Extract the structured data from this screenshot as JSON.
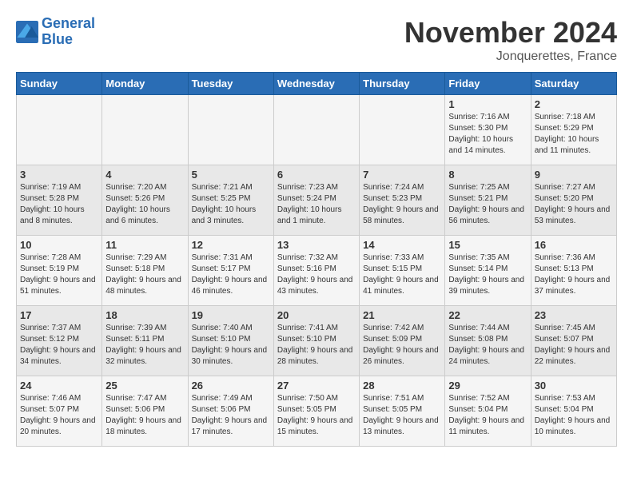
{
  "header": {
    "logo_line1": "General",
    "logo_line2": "Blue",
    "month_title": "November 2024",
    "location": "Jonquerettes, France"
  },
  "weekdays": [
    "Sunday",
    "Monday",
    "Tuesday",
    "Wednesday",
    "Thursday",
    "Friday",
    "Saturday"
  ],
  "weeks": [
    [
      {
        "day": "",
        "info": ""
      },
      {
        "day": "",
        "info": ""
      },
      {
        "day": "",
        "info": ""
      },
      {
        "day": "",
        "info": ""
      },
      {
        "day": "",
        "info": ""
      },
      {
        "day": "1",
        "info": "Sunrise: 7:16 AM\nSunset: 5:30 PM\nDaylight: 10 hours and 14 minutes."
      },
      {
        "day": "2",
        "info": "Sunrise: 7:18 AM\nSunset: 5:29 PM\nDaylight: 10 hours and 11 minutes."
      }
    ],
    [
      {
        "day": "3",
        "info": "Sunrise: 7:19 AM\nSunset: 5:28 PM\nDaylight: 10 hours and 8 minutes."
      },
      {
        "day": "4",
        "info": "Sunrise: 7:20 AM\nSunset: 5:26 PM\nDaylight: 10 hours and 6 minutes."
      },
      {
        "day": "5",
        "info": "Sunrise: 7:21 AM\nSunset: 5:25 PM\nDaylight: 10 hours and 3 minutes."
      },
      {
        "day": "6",
        "info": "Sunrise: 7:23 AM\nSunset: 5:24 PM\nDaylight: 10 hours and 1 minute."
      },
      {
        "day": "7",
        "info": "Sunrise: 7:24 AM\nSunset: 5:23 PM\nDaylight: 9 hours and 58 minutes."
      },
      {
        "day": "8",
        "info": "Sunrise: 7:25 AM\nSunset: 5:21 PM\nDaylight: 9 hours and 56 minutes."
      },
      {
        "day": "9",
        "info": "Sunrise: 7:27 AM\nSunset: 5:20 PM\nDaylight: 9 hours and 53 minutes."
      }
    ],
    [
      {
        "day": "10",
        "info": "Sunrise: 7:28 AM\nSunset: 5:19 PM\nDaylight: 9 hours and 51 minutes."
      },
      {
        "day": "11",
        "info": "Sunrise: 7:29 AM\nSunset: 5:18 PM\nDaylight: 9 hours and 48 minutes."
      },
      {
        "day": "12",
        "info": "Sunrise: 7:31 AM\nSunset: 5:17 PM\nDaylight: 9 hours and 46 minutes."
      },
      {
        "day": "13",
        "info": "Sunrise: 7:32 AM\nSunset: 5:16 PM\nDaylight: 9 hours and 43 minutes."
      },
      {
        "day": "14",
        "info": "Sunrise: 7:33 AM\nSunset: 5:15 PM\nDaylight: 9 hours and 41 minutes."
      },
      {
        "day": "15",
        "info": "Sunrise: 7:35 AM\nSunset: 5:14 PM\nDaylight: 9 hours and 39 minutes."
      },
      {
        "day": "16",
        "info": "Sunrise: 7:36 AM\nSunset: 5:13 PM\nDaylight: 9 hours and 37 minutes."
      }
    ],
    [
      {
        "day": "17",
        "info": "Sunrise: 7:37 AM\nSunset: 5:12 PM\nDaylight: 9 hours and 34 minutes."
      },
      {
        "day": "18",
        "info": "Sunrise: 7:39 AM\nSunset: 5:11 PM\nDaylight: 9 hours and 32 minutes."
      },
      {
        "day": "19",
        "info": "Sunrise: 7:40 AM\nSunset: 5:10 PM\nDaylight: 9 hours and 30 minutes."
      },
      {
        "day": "20",
        "info": "Sunrise: 7:41 AM\nSunset: 5:10 PM\nDaylight: 9 hours and 28 minutes."
      },
      {
        "day": "21",
        "info": "Sunrise: 7:42 AM\nSunset: 5:09 PM\nDaylight: 9 hours and 26 minutes."
      },
      {
        "day": "22",
        "info": "Sunrise: 7:44 AM\nSunset: 5:08 PM\nDaylight: 9 hours and 24 minutes."
      },
      {
        "day": "23",
        "info": "Sunrise: 7:45 AM\nSunset: 5:07 PM\nDaylight: 9 hours and 22 minutes."
      }
    ],
    [
      {
        "day": "24",
        "info": "Sunrise: 7:46 AM\nSunset: 5:07 PM\nDaylight: 9 hours and 20 minutes."
      },
      {
        "day": "25",
        "info": "Sunrise: 7:47 AM\nSunset: 5:06 PM\nDaylight: 9 hours and 18 minutes."
      },
      {
        "day": "26",
        "info": "Sunrise: 7:49 AM\nSunset: 5:06 PM\nDaylight: 9 hours and 17 minutes."
      },
      {
        "day": "27",
        "info": "Sunrise: 7:50 AM\nSunset: 5:05 PM\nDaylight: 9 hours and 15 minutes."
      },
      {
        "day": "28",
        "info": "Sunrise: 7:51 AM\nSunset: 5:05 PM\nDaylight: 9 hours and 13 minutes."
      },
      {
        "day": "29",
        "info": "Sunrise: 7:52 AM\nSunset: 5:04 PM\nDaylight: 9 hours and 11 minutes."
      },
      {
        "day": "30",
        "info": "Sunrise: 7:53 AM\nSunset: 5:04 PM\nDaylight: 9 hours and 10 minutes."
      }
    ]
  ]
}
